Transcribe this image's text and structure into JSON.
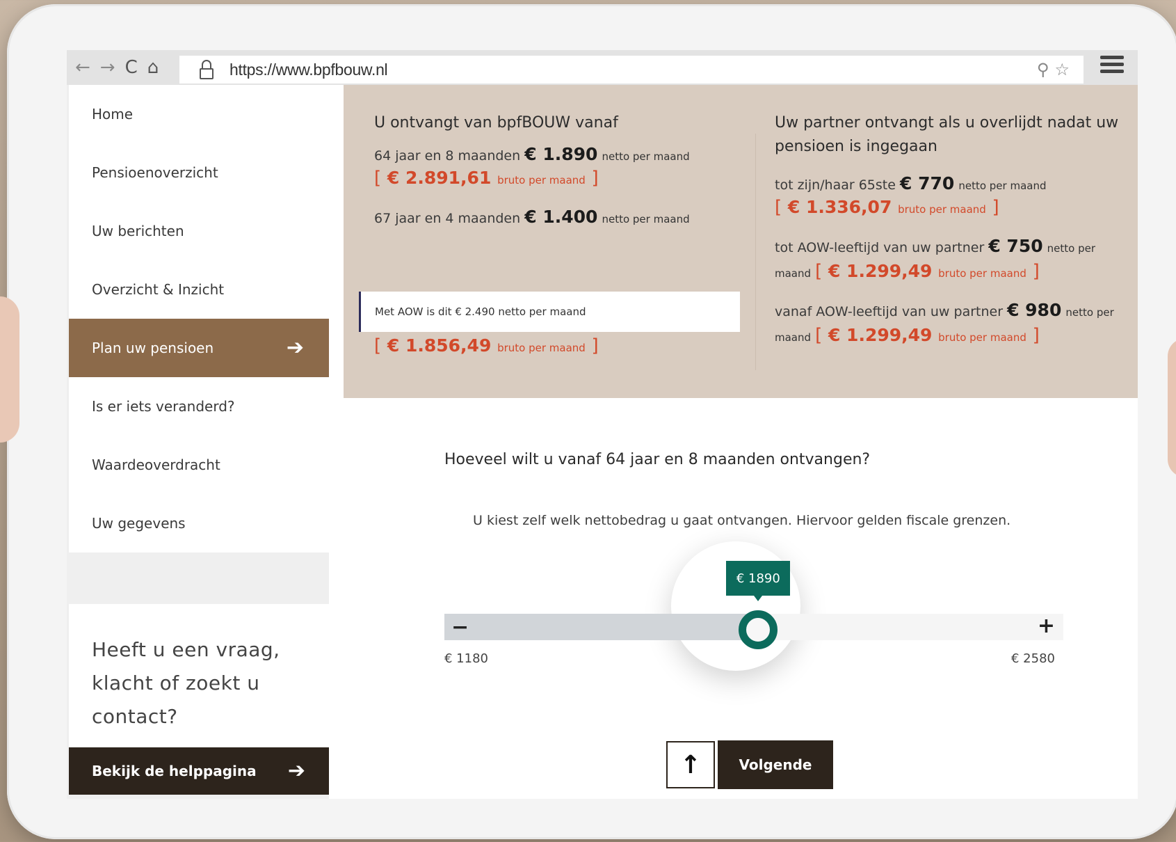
{
  "browser": {
    "url": "https://www.bpfbouw.nl",
    "icons": [
      "back-arrow-icon",
      "forward-arrow-icon",
      "reload-icon",
      "home-icon",
      "lock-icon",
      "search-icon",
      "star-icon",
      "hamburger-menu-icon"
    ]
  },
  "sidebar": {
    "items": [
      {
        "label": "Home"
      },
      {
        "label": "Pensioenoverzicht"
      },
      {
        "label": "Uw berichten"
      },
      {
        "label": "Overzicht & Inzicht"
      },
      {
        "label": "Plan uw pensioen",
        "active": true
      },
      {
        "label": "Is er iets veranderd?"
      },
      {
        "label": "Waardeoverdracht"
      },
      {
        "label": "Uw gegevens"
      }
    ],
    "help_title": "Heeft u een vraag, klacht of zoekt u contact?",
    "help_button": "Bekijk de helppagina"
  },
  "summary": {
    "left": {
      "title": "U ontvangt van bpfBOUW vanaf",
      "line1_prefix": "64 jaar en 8 maanden",
      "line1_amount": "€ 1.890",
      "line1_suffix": "netto per maand",
      "line1_gross": "€ 2.891,61",
      "line1_gross_suffix": "bruto per maand",
      "line2_prefix": "67 jaar en 4 maanden",
      "line2_amount": "€ 1.400",
      "line2_suffix": "netto per maand",
      "aow_note": "Met AOW is dit  € 2.490 netto per maand",
      "aow_gross": "€ 1.856,49",
      "aow_gross_suffix": "bruto per maand"
    },
    "right": {
      "title": "Uw partner ontvangt als u overlijdt nadat uw pensioen is ingegaan",
      "line1_prefix": "tot zijn/haar 65ste",
      "line1_amount": "€ 770",
      "line1_suffix": "netto per maand",
      "line1_gross": "€ 1.336,07",
      "line1_gross_suffix": "bruto per maand",
      "line2_prefix": "tot AOW-leeftijd van uw partner",
      "line2_amount": "€ 750",
      "line2_suffix_a": "netto per",
      "line2_suffix_b": "maand",
      "line2_gross": "€ 1.299,49",
      "line2_gross_suffix": "bruto per maand",
      "line3_prefix": "vanaf AOW-leeftijd van uw partner",
      "line3_amount": "€ 980",
      "line3_suffix_a": "netto per",
      "line3_suffix_b": "maand",
      "line3_gross": "€ 1.299,49",
      "line3_gross_suffix": "bruto per maand"
    }
  },
  "question": {
    "title": "Hoeveel wilt u vanaf 64 jaar en 8 maanden ontvangen?",
    "subtitle": "U kiest zelf welk nettobedrag u gaat ontvangen. Hiervoor gelden fiscale grenzen.",
    "slider": {
      "min": 1180,
      "max": 2580,
      "value": 1890,
      "min_label": "€ 1180",
      "max_label": "€ 2580",
      "value_label": "€ 1890",
      "minus_label": "−",
      "plus_label": "+",
      "accent_color": "#0c6b5c"
    },
    "up_button_icon": "arrow-up-icon",
    "next_button": "Volgende"
  },
  "colors": {
    "brand_brown": "#8c6a4a",
    "dark_brown": "#2d241c",
    "summary_bg": "#d9ccc0",
    "gross_red": "#d2492a"
  }
}
